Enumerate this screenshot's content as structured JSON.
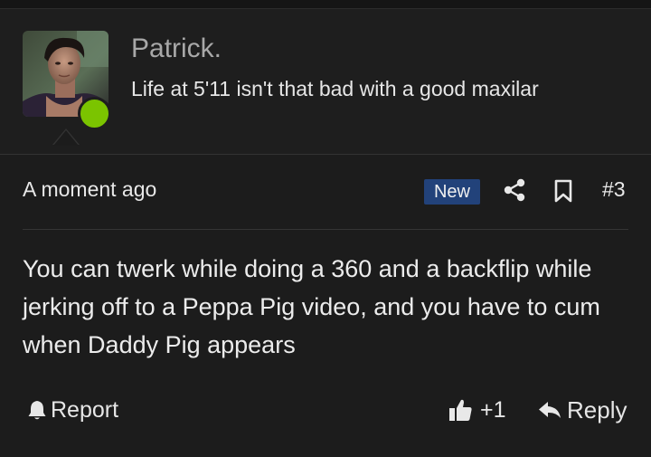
{
  "post": {
    "author": {
      "name": "Patrick.",
      "signature": "Life at 5'11 isn't that bad with a good maxilar",
      "avatar_icon": "user-avatar-photo",
      "online": true,
      "online_color": "#7bc400"
    },
    "timestamp": "A moment ago",
    "badge": "New",
    "badge_color": "#22427a",
    "number": "#3",
    "body": "You can twerk while doing a 360 and a backflip while jerking off to a Peppa Pig video, and you have to cum when Daddy Pig appears",
    "actions": {
      "report_label": "Report",
      "like_count": "+1",
      "reply_label": "Reply"
    },
    "icons": {
      "share": "share-icon",
      "bookmark": "bookmark-icon",
      "report": "bell-icon",
      "like": "thumbs-up-icon",
      "reply": "reply-arrow-icon"
    }
  }
}
